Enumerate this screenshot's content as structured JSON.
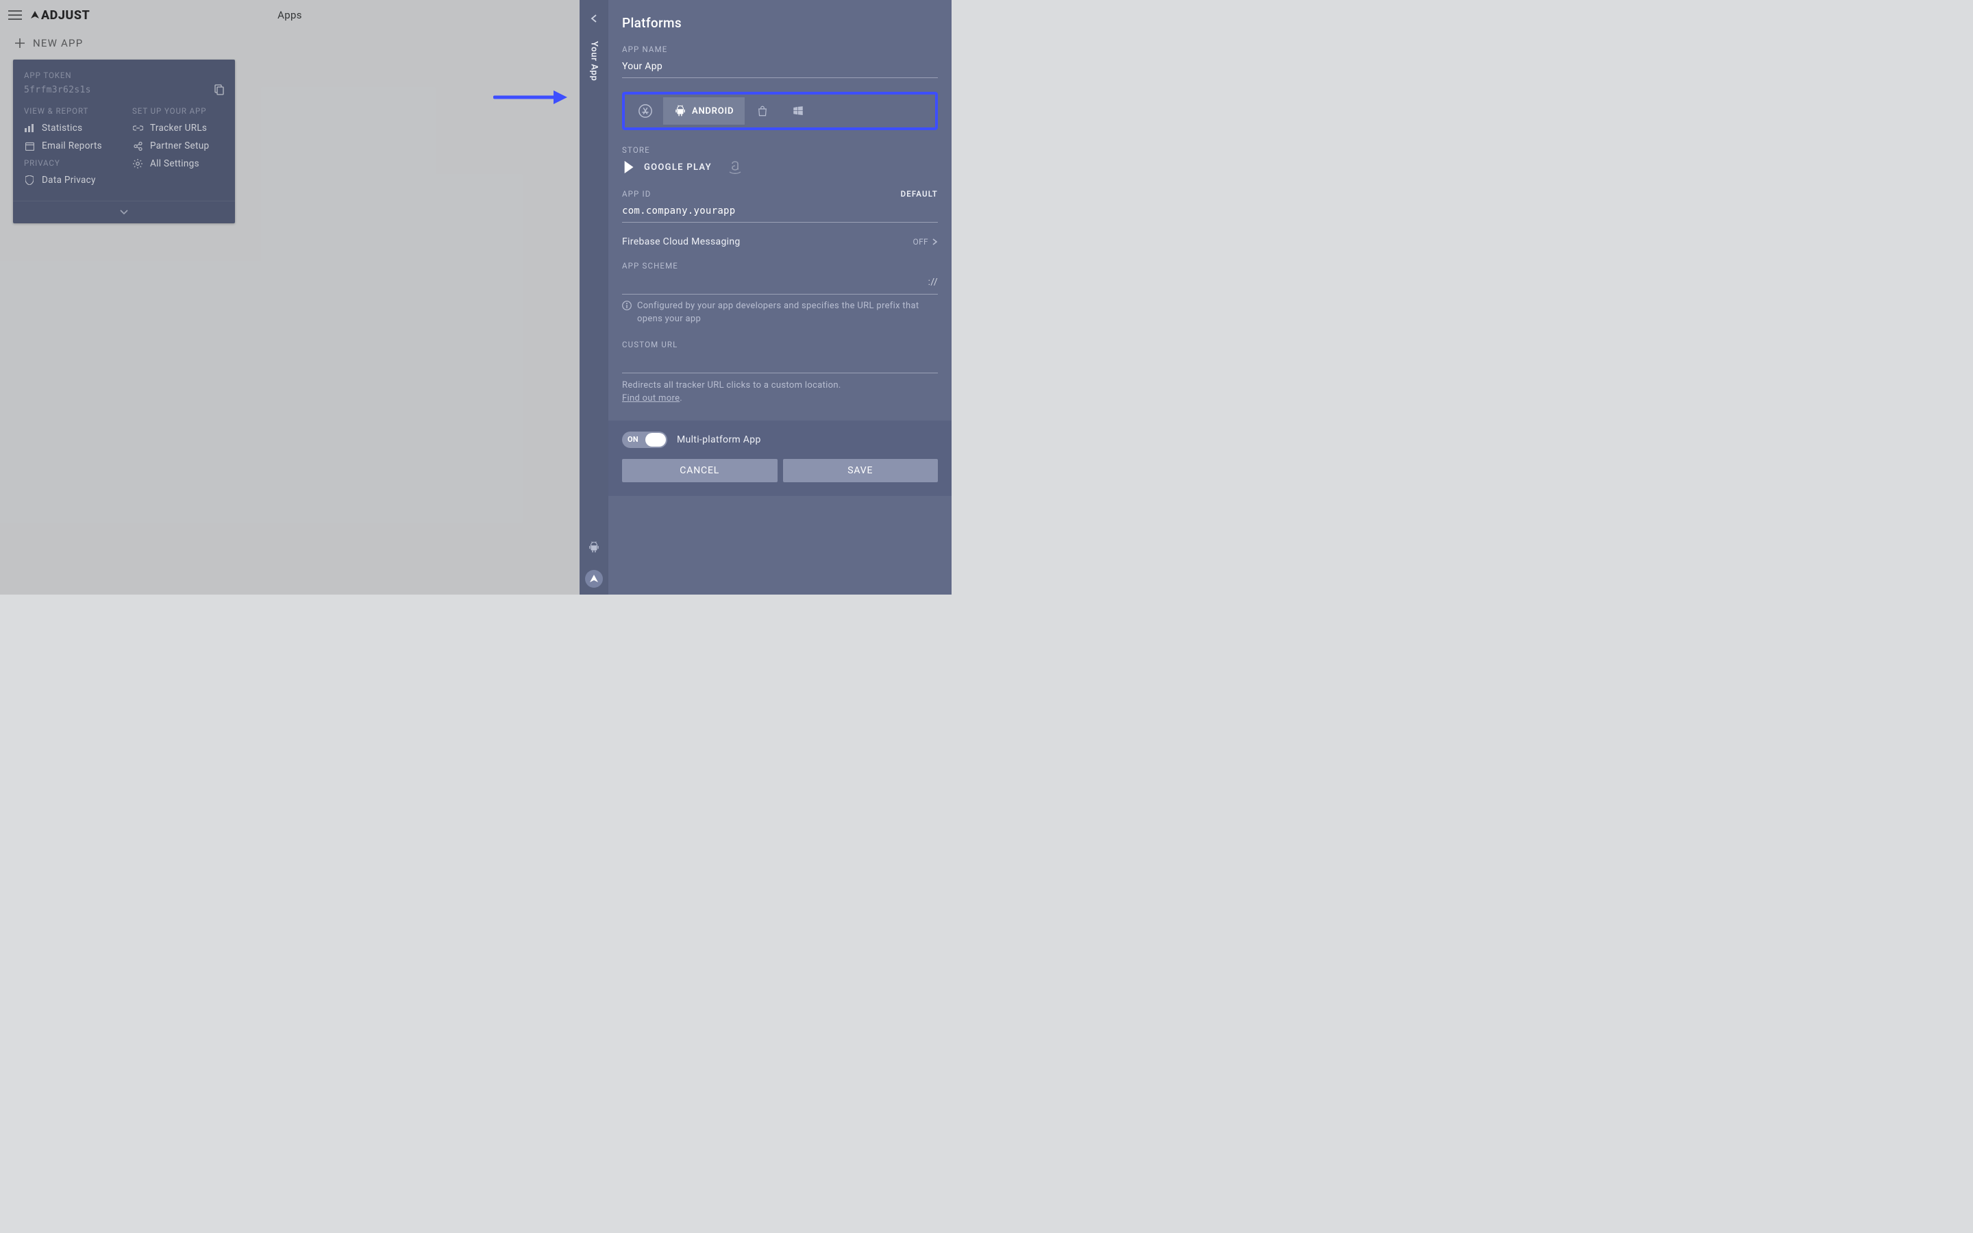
{
  "header": {
    "title": "Apps",
    "logo": "ADJUST"
  },
  "new_app_label": "NEW APP",
  "card": {
    "token_label": "APP TOKEN",
    "token_value": "5frfm3r62s1s",
    "col1_title": "VIEW & REPORT",
    "col2_title": "SET UP YOUR APP",
    "links_left": {
      "stats": "Statistics",
      "email": "Email Reports",
      "privacy_label": "PRIVACY",
      "data_privacy": "Data Privacy"
    },
    "links_right": {
      "tracker": "Tracker URLs",
      "partner": "Partner Setup",
      "settings": "All Settings"
    }
  },
  "rail": {
    "tab_label": "Your App"
  },
  "panel": {
    "title": "Platforms",
    "app_name_label": "APP NAME",
    "app_name_value": "Your App",
    "platforms": {
      "android_label": "ANDROID"
    },
    "store_label": "STORE",
    "stores": {
      "google_play": "GOOGLE PLAY"
    },
    "app_id_label": "APP ID",
    "app_id_right": "DEFAULT",
    "app_id_value": "com.company.yourapp",
    "firebase_label": "Firebase Cloud Messaging",
    "firebase_state": "OFF",
    "app_scheme_label": "APP SCHEME",
    "app_scheme_suffix": "://",
    "app_scheme_help": "Configured by your app developers and specifies the URL prefix that opens your app",
    "custom_url_label": "CUSTOM URL",
    "custom_url_help_1": "Redirects all tracker URL clicks to a custom location. ",
    "custom_url_link": "Find out more",
    "toggle_state": "ON",
    "toggle_label": "Multi-platform App",
    "cancel": "CANCEL",
    "save": "SAVE"
  }
}
